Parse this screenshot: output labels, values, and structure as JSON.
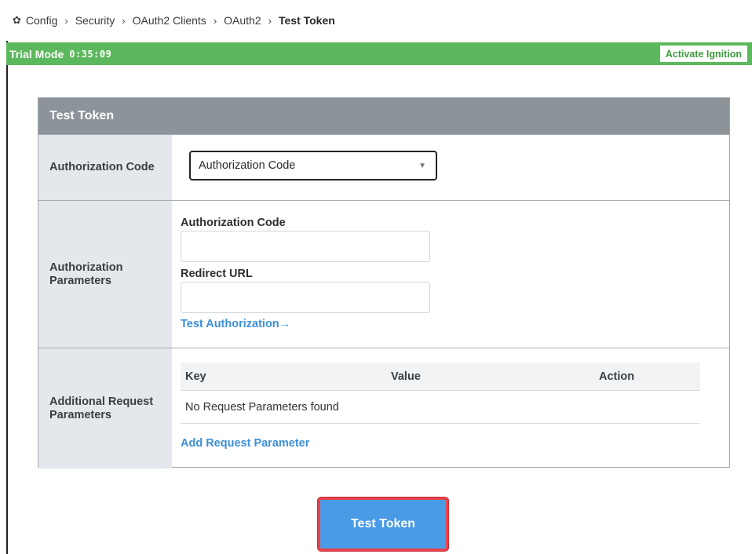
{
  "breadcrumb": {
    "icon": "gear-icon",
    "items": [
      "Config",
      "Security",
      "OAuth2 Clients",
      "OAuth2"
    ],
    "current": "Test Token"
  },
  "trial": {
    "label": "Trial Mode",
    "time": "0:35:09",
    "activate_label": "Activate Ignition"
  },
  "panel": {
    "title": "Test Token",
    "auth_code_row": {
      "label": "Authorization Code",
      "select_value": "Authorization Code"
    },
    "auth_params_row": {
      "label": "Authorization Parameters",
      "code_label": "Authorization Code",
      "code_value": "",
      "redirect_label": "Redirect URL",
      "redirect_value": "",
      "test_link": "Test Authorization"
    },
    "additional_row": {
      "label": "Additional Request Parameters",
      "columns": [
        "Key",
        "Value",
        "Action"
      ],
      "empty_text": "No Request Parameters found",
      "add_link": "Add Request Parameter"
    }
  },
  "test_button_label": "Test Token",
  "colors": {
    "trial_green": "#5cb85c",
    "header_gray": "#8c9499",
    "label_bg": "#e4e7ec",
    "link_blue": "#3d8fd8",
    "button_blue": "#4a9be6",
    "highlight_red": "#e8434a"
  }
}
